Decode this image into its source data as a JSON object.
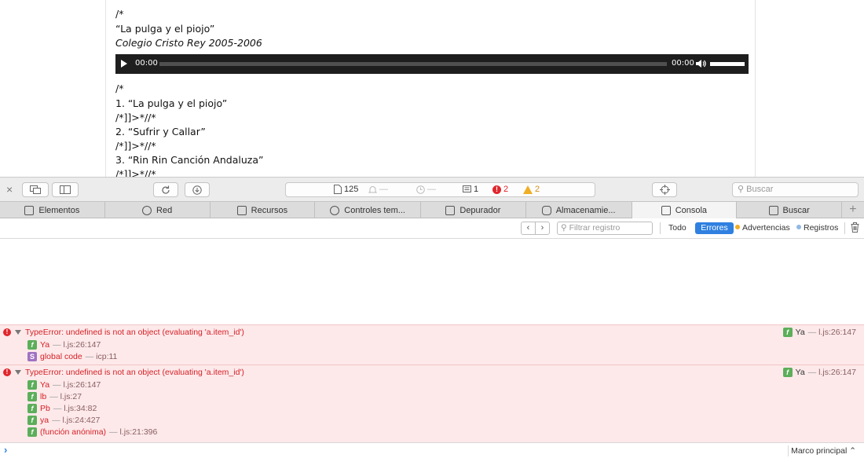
{
  "page": {
    "lines": [
      {
        "text": "/*",
        "italic": false
      },
      {
        "text": "“La pulga y el piojo”",
        "italic": false
      },
      {
        "text": "Colegio Cristo Rey 2005-2006",
        "italic": true
      }
    ],
    "player": {
      "current_time": "00:00",
      "duration": "00:00",
      "progress": 0,
      "volume": 1.0
    },
    "lines2": [
      "/*",
      "1. “La pulga y el piojo”",
      "/*]]>*//*",
      "2. “Sufrir y Callar”",
      "/*]]>*//*",
      "3. “Rin Rin Canción Andaluza”",
      "/*]]>*//*"
    ]
  },
  "toolbar": {
    "close": "×",
    "resources_count": "125",
    "load_dash": "—",
    "time_dash": "—",
    "logs_count": "1",
    "errors_count": "2",
    "warnings_count": "2",
    "search_placeholder": "Buscar"
  },
  "tabs": [
    {
      "label": "Elementos",
      "icon": "elements-icon",
      "active": false
    },
    {
      "label": "Red",
      "icon": "network-icon",
      "active": false
    },
    {
      "label": "Recursos",
      "icon": "resources-icon",
      "active": false
    },
    {
      "label": "Controles tem...",
      "icon": "timeline-icon",
      "active": false
    },
    {
      "label": "Depurador",
      "icon": "debugger-icon",
      "active": false
    },
    {
      "label": "Almacenamie...",
      "icon": "storage-icon",
      "active": false
    },
    {
      "label": "Consola",
      "icon": "console-icon",
      "active": true
    },
    {
      "label": "Buscar",
      "icon": "search-icon",
      "active": false
    }
  ],
  "filter": {
    "placeholder": "Filtrar registro",
    "all": "Todo",
    "errors": "Errores",
    "warnings": "Advertencias",
    "logs": "Registros",
    "selected": "Errores",
    "warn_color": "#f0ae26",
    "log_color": "#8fb8e6"
  },
  "errors": [
    {
      "message": "TypeError: undefined is not an object (evaluating 'a.item_id')",
      "location": {
        "fn": "Ya",
        "file": "l.js:26:147"
      },
      "frames": [
        {
          "badge": "f",
          "name": "Ya",
          "loc": "l.js:26:147"
        },
        {
          "badge": "s",
          "name": "global code",
          "loc": "icp:11"
        }
      ]
    },
    {
      "message": "TypeError: undefined is not an object (evaluating 'a.item_id')",
      "location": {
        "fn": "Ya",
        "file": "l.js:26:147"
      },
      "frames": [
        {
          "badge": "f",
          "name": "Ya",
          "loc": "l.js:26:147"
        },
        {
          "badge": "f",
          "name": "lb",
          "loc": "l.js:27"
        },
        {
          "badge": "f",
          "name": "Pb",
          "loc": "l.js:34:82"
        },
        {
          "badge": "f",
          "name": "ya",
          "loc": "l.js:24:427"
        },
        {
          "badge": "f",
          "name": "(función anónima)",
          "loc": "l.js:21:396"
        }
      ]
    }
  ],
  "prompt": {
    "chevron": "›",
    "context": "Marco principal ⌃"
  }
}
